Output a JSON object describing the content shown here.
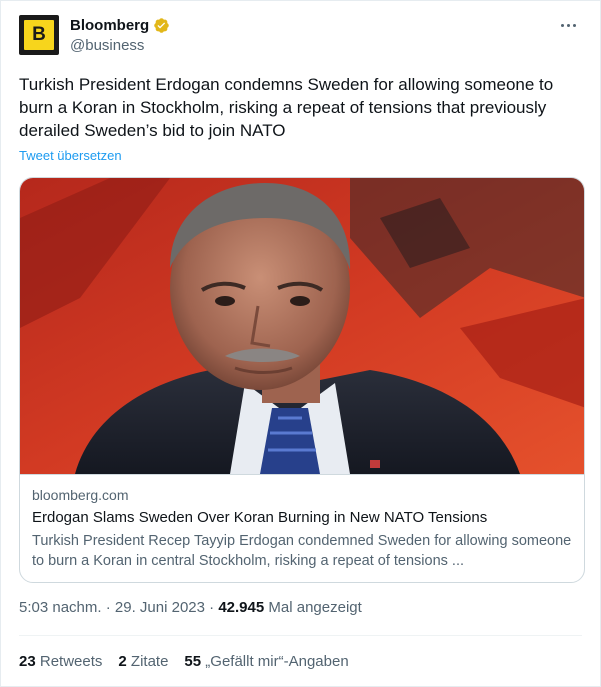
{
  "author": {
    "display_name": "Bloomberg",
    "handle": "@business",
    "avatar_letter": "B",
    "verified_color": "#e2b719"
  },
  "tweet": {
    "text": "Turkish President Erdogan condemns Sweden for allowing someone to burn a Koran in Stockholm, risking a repeat of tensions that previously derailed Sweden’s bid to join NATO",
    "translate_label": "Tweet übersetzen"
  },
  "card": {
    "domain": "bloomberg.com",
    "title": "Erdogan Slams Sweden Over Koran Burning in New NATO Tensions",
    "description": "Turkish President Recep Tayyip Erdogan condemned Sweden for allowing someone to burn a Koran in central Stockholm, risking a repeat of tensions ..."
  },
  "meta": {
    "time": "5:03 nachm.",
    "separator": "·",
    "date": "29. Juni 2023",
    "views_count": "42.945",
    "views_label": "Mal angezeigt"
  },
  "stats": {
    "retweets_count": "23",
    "retweets_label": "Retweets",
    "quotes_count": "2",
    "quotes_label": "Zitate",
    "likes_count": "55",
    "likes_label": "„Gefällt mir“-Angaben"
  },
  "colors": {
    "link": "#1d9bf0",
    "secondary_text": "#536471",
    "primary_text": "#0f1419",
    "brand_yellow": "#f7d51c"
  }
}
